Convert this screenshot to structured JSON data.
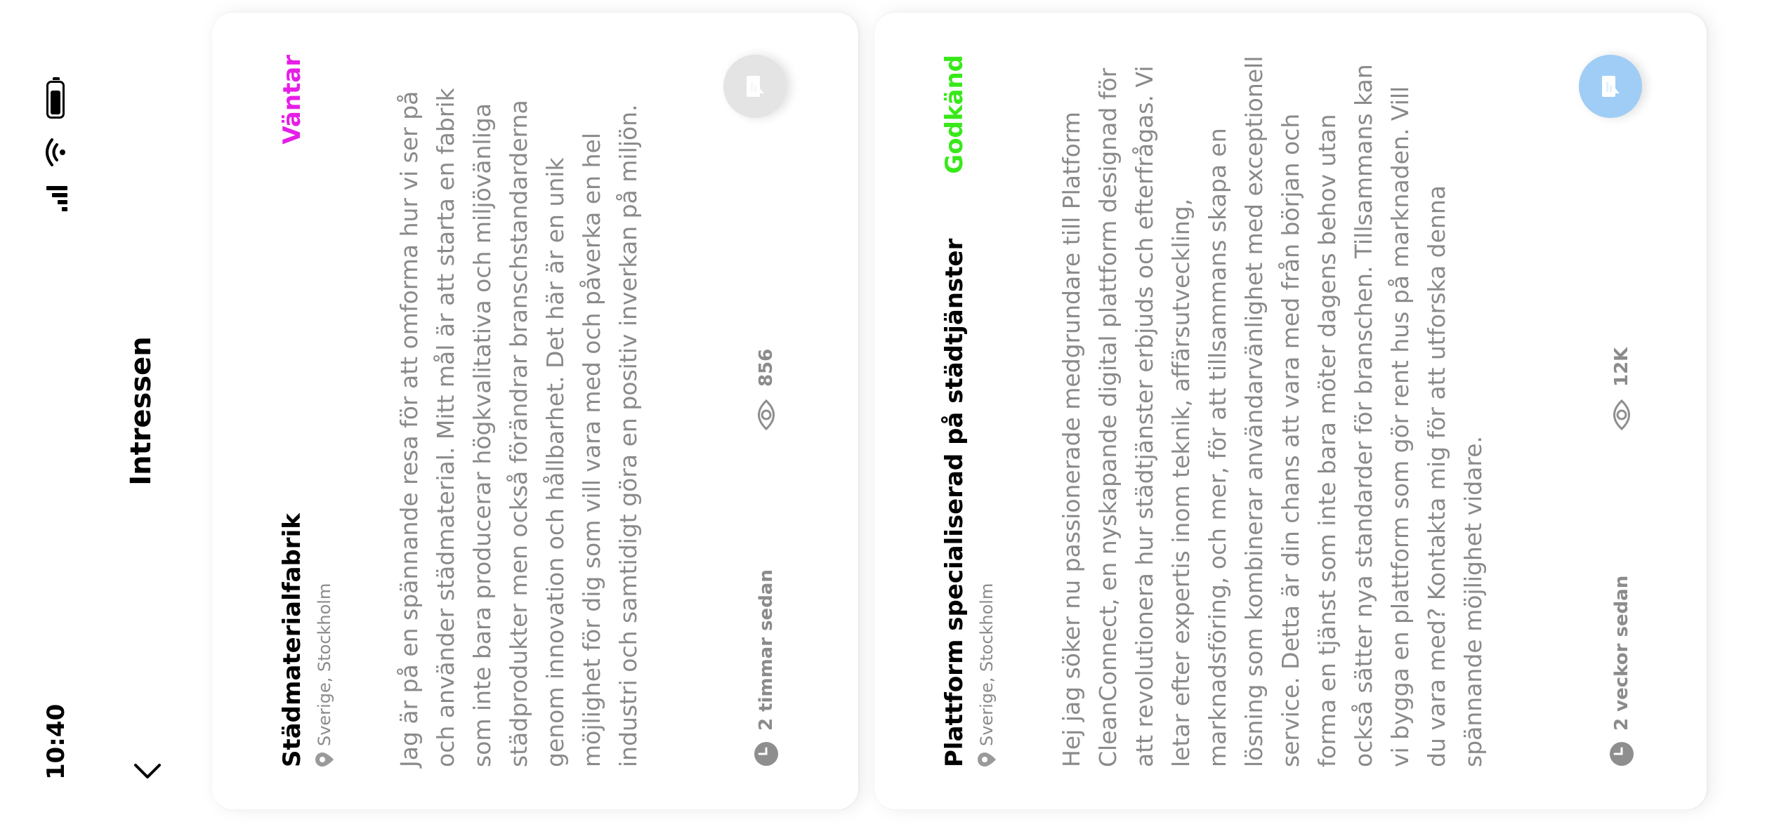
{
  "status_bar": {
    "time": "10:40"
  },
  "header": {
    "title": "Intressen"
  },
  "cards": [
    {
      "title": "Städmaterialfabrik",
      "location": "Sverige, Stockholm",
      "status": "Väntar",
      "status_color": "#e61ee6",
      "body": "Jag är på en spännande resa för att omforma hur vi ser på och använder städmaterial. Mitt mål är att starta en fabrik som inte bara producerar högkvalitativa och miljövänliga städprodukter men också förändrar branschstandarderna genom innovation och hållbarhet. Det här är en unik möjlighet för dig som vill vara med och påverka en hel industri och samtidigt göra en positiv inverkan på miljön.",
      "posted": "2 timmar sedan",
      "views": "856",
      "chat_color": "#e4e4e4"
    },
    {
      "title": "Plattform specialiserad på städtjänster",
      "location": "Sverige, Stockholm",
      "status": "Godkänd",
      "status_color": "#38e81a",
      "body": "Hej jag söker nu passionerade medgrundare till Platform CleanConnect, en nyskapande digital plattform designad för att revolutionera hur städtjänster erbjuds och efterfrågas. Vi letar efter expertis inom teknik, affärsutveckling, marknadsföring, och mer, för att tillsammans skapa en lösning som kombinerar användarvänlighet med exceptionell service. Detta är din chans att vara med från början och forma en tjänst som inte bara möter dagens behov utan också sätter nya standarder för branschen. Tillsammans kan vi bygga en plattform som gör rent hus på marknaden. Vill du vara med? Kontakta mig för att utforska denna spännande möjlighet vidare.",
      "posted": "2 veckor sedan",
      "views": "12K",
      "chat_color": "#9fcdf5"
    }
  ]
}
